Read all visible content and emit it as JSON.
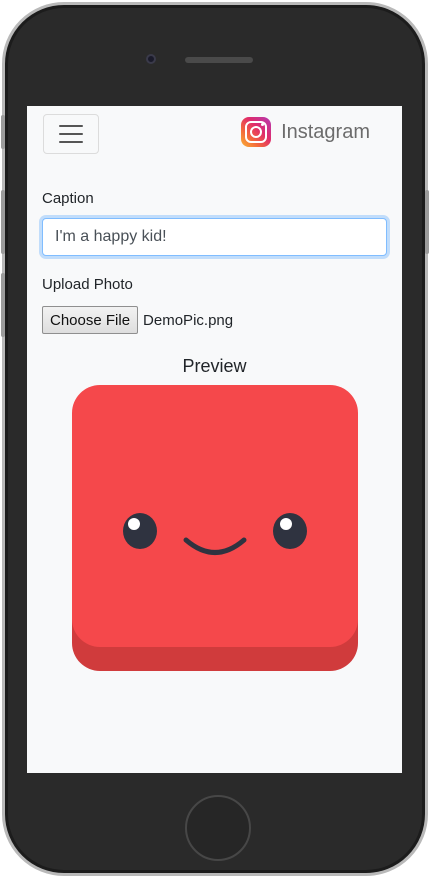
{
  "navbar": {
    "menu_icon": "hamburger-menu-icon",
    "brand_icon": "instagram-logo-icon",
    "brand_text": "Instagram"
  },
  "form": {
    "caption_label": "Caption",
    "caption_value": "I'm a happy kid!",
    "upload_label": "Upload Photo",
    "file_button_label": "Choose File",
    "file_name": "DemoPic.png"
  },
  "preview": {
    "title": "Preview",
    "image_description_icon": "smiling-red-square-emoji",
    "colors": {
      "face": "#f5484b",
      "face_shadow": "#d03b3c",
      "features": "#2f3340"
    }
  },
  "colors": {
    "screen_bg": "#f8f9fa",
    "input_focus_border": "#80bdff",
    "phone_body": "#2a2a2a"
  }
}
